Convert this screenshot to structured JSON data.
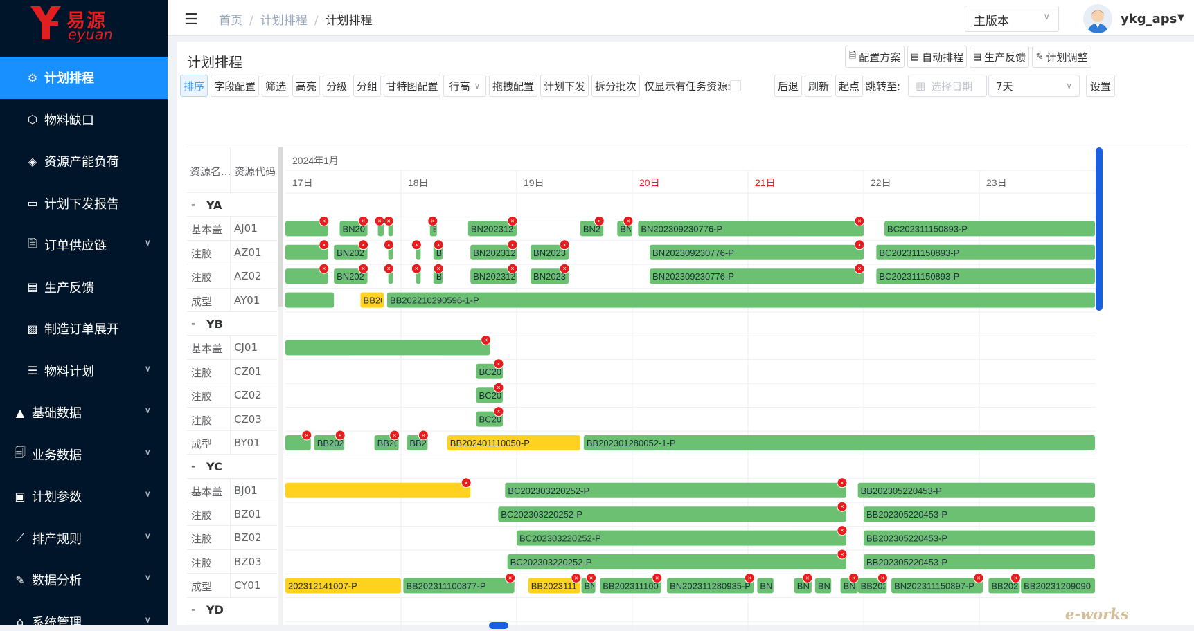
{
  "app": {
    "logo_cn": "易源",
    "logo_en": "eyuan"
  },
  "sidebar": {
    "items": [
      {
        "label": "计划排程",
        "icon": "gear-icon",
        "active": true,
        "chev": false
      },
      {
        "label": "物料缺口",
        "icon": "cube-icon",
        "chev": false
      },
      {
        "label": "资源产能负荷",
        "icon": "layers-icon",
        "chev": false
      },
      {
        "label": "计划下发报告",
        "icon": "report-icon",
        "chev": false
      },
      {
        "label": "订单供应链",
        "icon": "document-icon",
        "chev": true
      },
      {
        "label": "生产反馈",
        "icon": "feedback-icon",
        "chev": false
      },
      {
        "label": "制造订单展开",
        "icon": "expand-icon",
        "chev": false
      },
      {
        "label": "物料计划",
        "icon": "list-icon",
        "chev": true
      },
      {
        "label": "基础数据",
        "icon": "triangle-icon",
        "chev": true,
        "top": true
      },
      {
        "label": "业务数据",
        "icon": "data-icon",
        "chev": true,
        "top": true
      },
      {
        "label": "计划参数",
        "icon": "params-icon",
        "chev": true,
        "top": true
      },
      {
        "label": "排产规则",
        "icon": "rule-icon",
        "chev": true,
        "top": true
      },
      {
        "label": "数据分析",
        "icon": "edit-icon",
        "chev": true,
        "top": true
      },
      {
        "label": "系统管理",
        "icon": "system-icon",
        "chev": true,
        "top": true
      }
    ]
  },
  "header": {
    "breadcrumb": [
      "首页",
      "计划排程",
      "计划排程"
    ],
    "version": "主版本",
    "user": "ykg_aps"
  },
  "panel": {
    "title": "计划排程",
    "actions": [
      "配置方案",
      "自动排程",
      "生产反馈",
      "计划调整"
    ],
    "toolbar": [
      "排序",
      "字段配置",
      "筛选",
      "高亮",
      "分级",
      "分组",
      "甘特图配置",
      "行高",
      "拖拽配置",
      "计划下发",
      "拆分批次"
    ],
    "only_task_label": "仅显示有任务资源:",
    "nav_buttons": [
      "后退",
      "刷新",
      "起点"
    ],
    "jump_label": "跳转至:",
    "date_placeholder": "选择日期",
    "range_value": "7天",
    "settings": "设置"
  },
  "gantt": {
    "headers": [
      "资源名...",
      "资源代码"
    ],
    "month": "2024年1月",
    "days": [
      {
        "label": "17日",
        "weekend": false
      },
      {
        "label": "18日",
        "weekend": false
      },
      {
        "label": "19日",
        "weekend": false
      },
      {
        "label": "20日",
        "weekend": true
      },
      {
        "label": "21日",
        "weekend": true
      },
      {
        "label": "22日",
        "weekend": false
      },
      {
        "label": "23日",
        "weekend": false
      }
    ],
    "rows": [
      {
        "group": "YA"
      },
      {
        "name": "基本盖",
        "code": "AJ01",
        "bars": [
          [
            0,
            0.37,
            "",
            "g",
            1
          ],
          [
            0.47,
            0.71,
            "BN20",
            "g",
            1
          ],
          [
            0.8,
            0.85,
            "",
            "g",
            1
          ],
          [
            0.89,
            0.93,
            "",
            "g",
            1
          ],
          [
            1.25,
            1.31,
            "B",
            "g",
            1
          ],
          [
            1.58,
            2.0,
            "BN202312",
            "g",
            1
          ],
          [
            2.55,
            2.75,
            "BN2",
            "g",
            1
          ],
          [
            2.87,
            3.0,
            "BN",
            "g",
            1
          ],
          [
            3.05,
            5.0,
            "BN202309230776-P",
            "g",
            1
          ],
          [
            5.18,
            7.0,
            "BC202311150893-P",
            "g",
            0
          ]
        ]
      },
      {
        "name": "注胶",
        "code": "AZ01",
        "bars": [
          [
            0,
            0.37,
            "",
            "g",
            1
          ],
          [
            0.42,
            0.71,
            "BN202",
            "g",
            1
          ],
          [
            0.89,
            0.93,
            "",
            "g",
            1
          ],
          [
            1.13,
            1.17,
            "",
            "g",
            1
          ],
          [
            1.28,
            1.36,
            "B",
            "g",
            1
          ],
          [
            1.6,
            2.0,
            "BN202312",
            "g",
            1
          ],
          [
            2.12,
            2.45,
            "BN2023",
            "g",
            1
          ],
          [
            3.15,
            5.0,
            "BN202309230776-P",
            "g",
            1
          ],
          [
            5.11,
            7.0,
            "BC202311150893-P",
            "g",
            0
          ]
        ]
      },
      {
        "name": "注胶",
        "code": "AZ02",
        "bars": [
          [
            0,
            0.37,
            "",
            "g",
            1
          ],
          [
            0.42,
            0.71,
            "BN202",
            "g",
            1
          ],
          [
            0.89,
            0.93,
            "",
            "g",
            1
          ],
          [
            1.13,
            1.17,
            "",
            "g",
            1
          ],
          [
            1.28,
            1.36,
            "B",
            "g",
            1
          ],
          [
            1.6,
            2.0,
            "BN202312",
            "g",
            1
          ],
          [
            2.12,
            2.45,
            "BN2023",
            "g",
            1
          ],
          [
            3.15,
            5.0,
            "BN202309230776-P",
            "g",
            1
          ],
          [
            5.11,
            7.0,
            "BC202311150893-P",
            "g",
            0
          ]
        ]
      },
      {
        "name": "成型",
        "code": "AY01",
        "bars": [
          [
            0,
            0.42,
            "",
            "g",
            0
          ],
          [
            0.65,
            0.85,
            "BB20",
            "y",
            0
          ],
          [
            0.88,
            7.0,
            "BB202210290596-1-P",
            "g",
            0
          ]
        ]
      },
      {
        "group": "YB"
      },
      {
        "name": "基本盖",
        "code": "CJ01",
        "bars": [
          [
            0,
            1.77,
            "",
            "g",
            1
          ]
        ]
      },
      {
        "name": "注胶",
        "code": "CZ01",
        "bars": [
          [
            1.65,
            1.88,
            "BC20",
            "g",
            1
          ]
        ]
      },
      {
        "name": "注胶",
        "code": "CZ02",
        "bars": [
          [
            1.65,
            1.88,
            "BC20",
            "g",
            1
          ]
        ]
      },
      {
        "name": "注胶",
        "code": "CZ03",
        "bars": [
          [
            1.65,
            1.88,
            "BC20",
            "g",
            1
          ]
        ]
      },
      {
        "name": "成型",
        "code": "BY01",
        "bars": [
          [
            0,
            0.22,
            "",
            "g",
            1
          ],
          [
            0.25,
            0.51,
            "BB202",
            "g",
            1
          ],
          [
            0.77,
            0.98,
            "BB20",
            "g",
            1
          ],
          [
            1.05,
            1.23,
            "BB2",
            "g",
            1
          ],
          [
            1.4,
            2.55,
            "BB202401110050-P",
            "y",
            0
          ],
          [
            2.58,
            7.0,
            "BB202301280052-1-P",
            "g",
            0
          ]
        ]
      },
      {
        "group": "YC"
      },
      {
        "name": "基本盖",
        "code": "BJ01",
        "bars": [
          [
            0,
            1.6,
            "",
            "y",
            1
          ],
          [
            1.9,
            4.85,
            "BC202303220252-P",
            "g",
            1
          ],
          [
            4.95,
            7.0,
            "BB202305220453-P",
            "g",
            0
          ]
        ]
      },
      {
        "name": "注胶",
        "code": "BZ01",
        "bars": [
          [
            1.84,
            4.85,
            "BC202303220252-P",
            "g",
            1
          ],
          [
            5.0,
            7.0,
            "BB202305220453-P",
            "g",
            0
          ]
        ]
      },
      {
        "name": "注胶",
        "code": "BZ02",
        "bars": [
          [
            2.0,
            4.85,
            "BC202303220252-P",
            "g",
            1
          ],
          [
            5.0,
            7.0,
            "BB202305220453-P",
            "g",
            0
          ]
        ]
      },
      {
        "name": "注胶",
        "code": "BZ03",
        "bars": [
          [
            1.92,
            4.85,
            "BC202303220252-P",
            "g",
            1
          ],
          [
            5.0,
            7.0,
            "BB202305220453-P",
            "g",
            0
          ]
        ]
      },
      {
        "name": "成型",
        "code": "CY01",
        "bars": [
          [
            0,
            1.0,
            "202312141007-P",
            "y",
            0
          ],
          [
            1.02,
            1.98,
            "BB202311100877-P",
            "g",
            1
          ],
          [
            2.1,
            2.55,
            "BB2023111",
            "y",
            1
          ],
          [
            2.56,
            2.68,
            "BN",
            "g",
            1
          ],
          [
            2.72,
            3.25,
            "BB202311100",
            "g",
            1
          ],
          [
            3.3,
            4.05,
            "BN202311280935-P",
            "g",
            1
          ],
          [
            4.08,
            4.22,
            "BN",
            "g",
            0
          ],
          [
            4.4,
            4.55,
            "BN",
            "g",
            1
          ],
          [
            4.58,
            4.72,
            "BN",
            "g",
            0
          ],
          [
            4.8,
            4.95,
            "BN",
            "g",
            1
          ],
          [
            4.95,
            5.2,
            "BB202",
            "g",
            1
          ],
          [
            5.24,
            6.03,
            "BN202311150897-P",
            "g",
            1
          ],
          [
            6.08,
            6.35,
            "BB202",
            "g",
            1
          ],
          [
            6.36,
            7.0,
            "BB20231209090",
            "g",
            0
          ]
        ]
      },
      {
        "group": "YD"
      }
    ]
  },
  "colors": {
    "sidebar": "#001529",
    "active": "#1890ff",
    "bar_green": "#6cc072",
    "bar_yellow": "#ffd21f",
    "marker": "#e81c1c",
    "weekend": "#e02020",
    "scroll": "#1a5fe0"
  },
  "watermark": "e-works"
}
